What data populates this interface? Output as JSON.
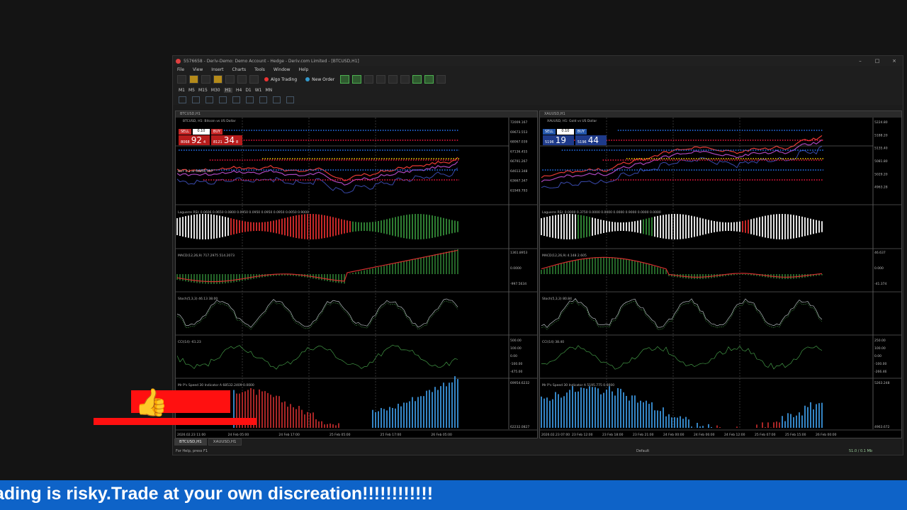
{
  "window": {
    "title": "5576658 - Deriv-Demo: Demo Account - Hedge - Deriv.com Limited - [BTCUSD,H1]",
    "menu": [
      "File",
      "View",
      "Insert",
      "Charts",
      "Tools",
      "Window",
      "Help"
    ],
    "algo_trading": "Algo Trading",
    "new_order": "New Order",
    "timeframes": [
      "M1",
      "M5",
      "M15",
      "M30",
      "H1",
      "H4",
      "D1",
      "W1",
      "MN"
    ],
    "active_timeframe": "H1"
  },
  "charts": [
    {
      "window_title": "BTCUSD,H1",
      "symbol_label": "BTCUSD, H1: Bitcoin vs US Dollar",
      "sell_label": "SELL",
      "buy_label": "BUY",
      "lot": "0.10",
      "bid_prefix": "8068",
      "bid_big": "92",
      "bid_sup": "4",
      "ask_prefix": "8121",
      "ask_big": "34",
      "ask_sup": "8",
      "position_line": "BUY 0.1 at 64850.397",
      "price_scale": [
        "72009.167",
        "69673.553",
        "68067.039",
        "67136.455",
        "66791.267",
        "64613.348",
        "63667.347",
        "61949.793"
      ],
      "current_price": "68034.7",
      "rsi_label": "Laguerre RSI: 0.0606 0.0650 0.0800 0.0950 0.0950 0.0950 0.0950 0.0050 0.9000",
      "macd_label": "MACD(12,26,9) 717.2975 514.2073",
      "macd_scale": [
        "1361.8953",
        "0.0000",
        "-997.5634"
      ],
      "stoch_label": "Stoch(5,3,3) 46.13 38.00",
      "cci_label": "CCI(14) -61.23",
      "cci_scale": [
        "500.00",
        "100.00",
        "0.00",
        "-100.00",
        "-475.00"
      ],
      "speed_label": "Mr P's Speed 30 Indicator A 68532.2409 0.0000",
      "speed_scale": [
        "69954.6232",
        "62232.0827"
      ],
      "time_labels": [
        "2026.02.23 11:00",
        "24 Feb 05:00",
        "24 Feb 17:00",
        "25 Feb 05:00",
        "25 Feb 17:00",
        "26 Feb 05:00"
      ],
      "tab": "BTCUSD,H1"
    },
    {
      "window_title": "XAUUSD,H1",
      "symbol_label": "XAUUSD, H1: Gold vs US Dollar",
      "sell_label": "SELL",
      "buy_label": "BUY",
      "lot": "0.10",
      "bid_prefix": "5196",
      "bid_big": "19",
      "bid_sup": "",
      "ask_prefix": "5196",
      "ask_big": "44",
      "ask_sup": "",
      "position_line": "",
      "price_scale": [
        "5224.80",
        "5188.20",
        "5135.40",
        "5081.80",
        "5029.20",
        "4963.28"
      ],
      "current_price": "5196.19",
      "rsi_label": "Laguerre RSI: 0.0000 0.3750 0.0000 0.0000 0.0000 0.9000 0.0000 0.0000",
      "macd_label": "MACD(12,26,9) 4.148 2.605",
      "macd_scale": [
        "46.637",
        "0.000",
        "-41.374"
      ],
      "stoch_label": "Stoch(5,3,3) 80.84",
      "cci_label": "CCI(14) 38.40",
      "cci_scale": [
        "250.00",
        "100.00",
        "0.00",
        "-100.00",
        "-266.46"
      ],
      "speed_label": "Mr P's Speed 30 Indicator A 5195.775 0.0000",
      "speed_scale": [
        "5263.248",
        "4963.672"
      ],
      "time_labels": [
        "2026.02.23 07:00",
        "23 Feb 12:00",
        "23 Feb 18:00",
        "23 Feb 21:00",
        "24 Feb 00:00",
        "24 Feb 06:00",
        "24 Feb 12:00",
        "25 Feb 07:00",
        "25 Feb 15:00",
        "26 Feb 00:00"
      ],
      "tab": "XAUUSD,H1"
    }
  ],
  "status": {
    "help": "For Help, press F1",
    "profile": "Default",
    "network": "51.0 / 0.1 Mb"
  },
  "ticker_text": "ading is risky.Trade at your own discreation!!!!!!!!!!!!"
}
